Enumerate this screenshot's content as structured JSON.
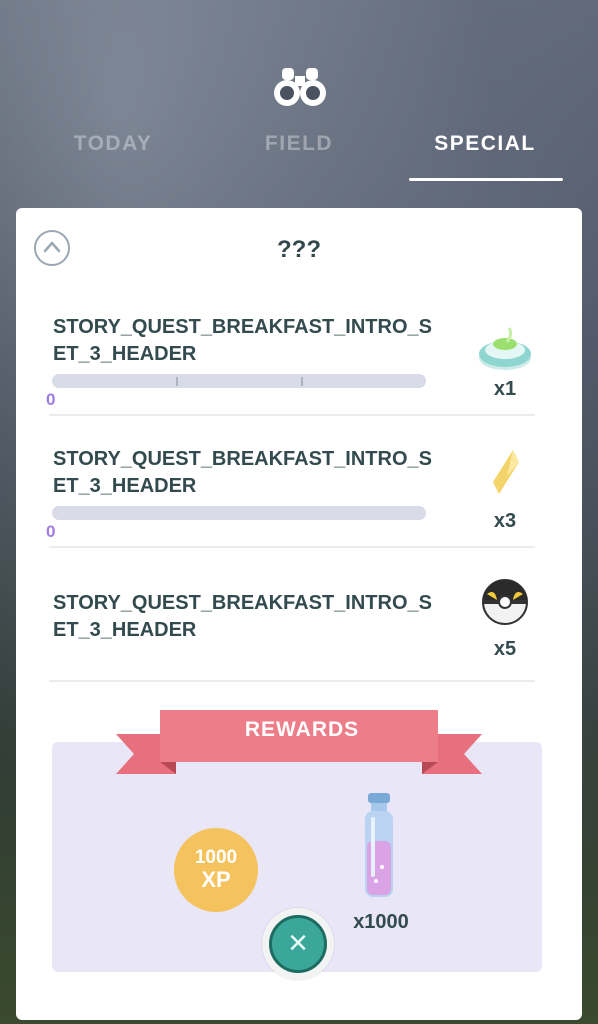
{
  "tabs": [
    {
      "label": "TODAY",
      "active": false
    },
    {
      "label": "FIELD",
      "active": false
    },
    {
      "label": "SPECIAL",
      "active": true
    }
  ],
  "header_icon": "binoculars-icon",
  "card": {
    "title": "???",
    "collapse_icon": "chevron-up-icon",
    "quests": [
      {
        "title": "STORY_QUEST_BREAKFAST_INTRO_SET_3_HEADER",
        "progress": "0",
        "progress_fraction": 0,
        "reward_icon": "incense-icon",
        "reward_qty": "x1"
      },
      {
        "title": "STORY_QUEST_BREAKFAST_INTRO_SET_3_HEADER",
        "progress": "0",
        "progress_fraction": 0,
        "reward_icon": "rare-candy-icon",
        "reward_qty": "x3"
      },
      {
        "title": "STORY_QUEST_BREAKFAST_INTRO_SET_3_HEADER",
        "reward_icon": "ultra-ball-icon",
        "reward_qty": "x5"
      }
    ]
  },
  "rewards": {
    "label": "REWARDS",
    "xp_amount": "1000",
    "xp_label": "XP",
    "stardust_icon": "stardust-icon",
    "stardust_qty": "x1000"
  },
  "close_icon": "close-icon",
  "colors": {
    "accent_ribbon": "#e8707e",
    "progress_text": "#9f7de0",
    "close_button": "#3aa79a",
    "xp_badge": "#f4c35e"
  }
}
